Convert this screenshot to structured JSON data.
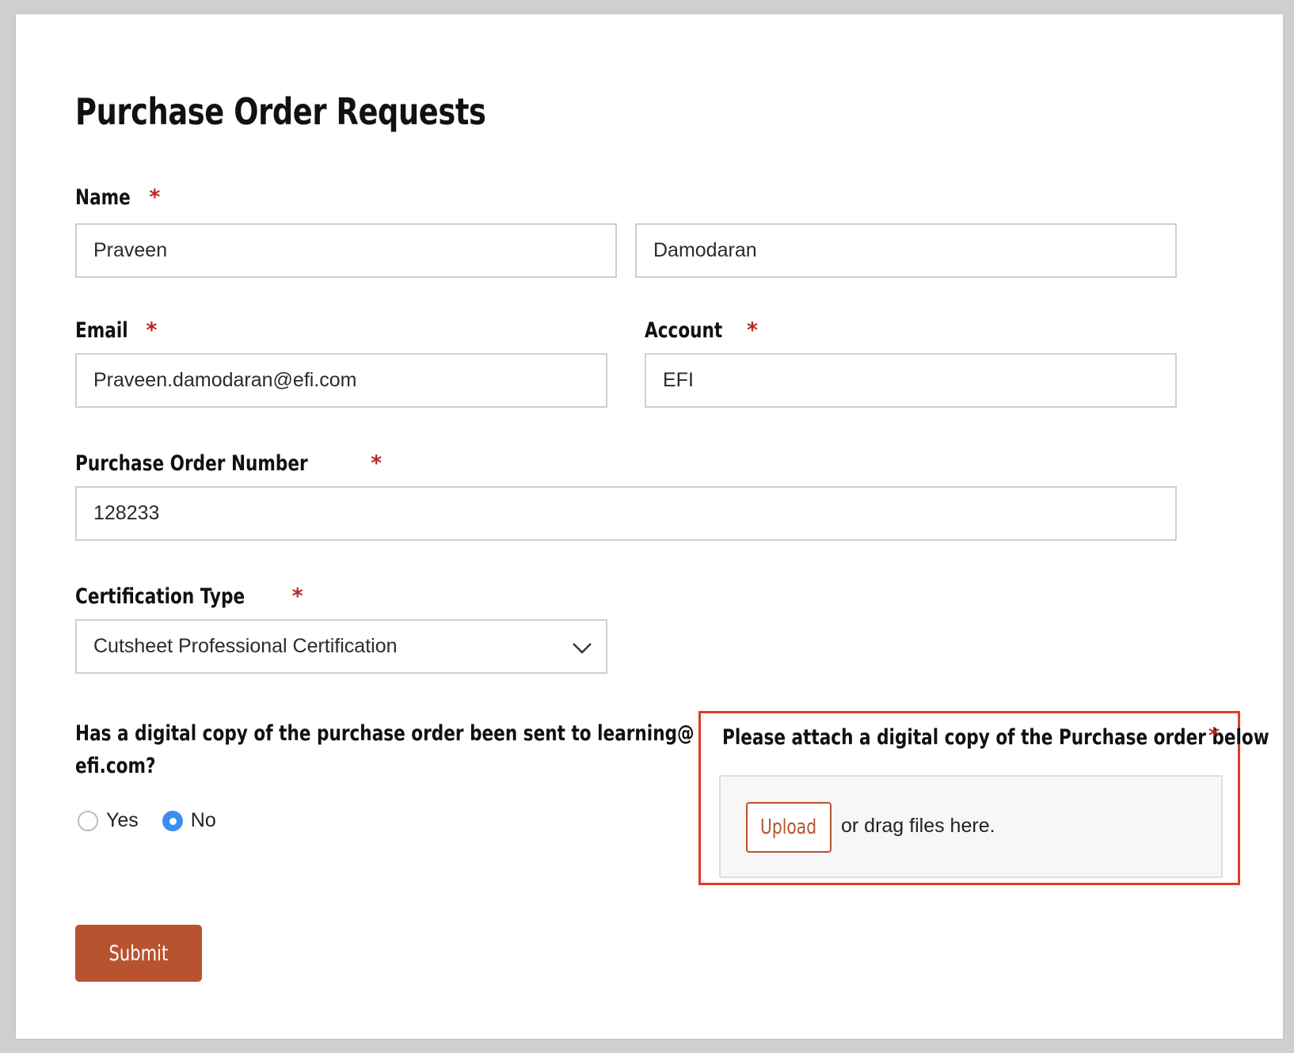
{
  "form": {
    "title": "Purchase Order Requests",
    "required_marker": "*",
    "name": {
      "label": "Name",
      "first": "Praveen",
      "last": "Damodaran"
    },
    "email": {
      "label": "Email",
      "value": "Praveen.damodaran@efi.com"
    },
    "account": {
      "label": "Account",
      "value": "EFI"
    },
    "po_number": {
      "label": "Purchase Order Number",
      "value": "128233"
    },
    "certification": {
      "label": "Certification Type",
      "selected": "Cutsheet Professional Certification"
    },
    "digital_copy": {
      "question_line1": "Has a digital copy of the purchase order been sent to learning@",
      "question_line2": "efi.com?",
      "options": [
        "Yes",
        "No"
      ],
      "selected": "No"
    },
    "attachment": {
      "label": "Please attach a digital copy of the Purchase order below",
      "upload_label": "Upload",
      "drag_text": "or drag files here."
    },
    "submit_label": "Submit"
  },
  "colors": {
    "accent": "#b7532f",
    "required": "#b22a24",
    "highlight_border": "#e23b25",
    "radio_selected": "#3b8ef0"
  },
  "icons": {
    "select_arrow": "chevron-down-icon"
  }
}
